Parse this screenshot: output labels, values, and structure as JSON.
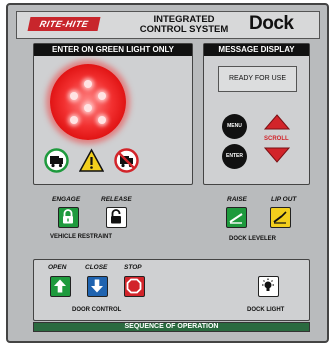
{
  "header": {
    "brand_logo": "RITE-HITE",
    "system_title_line1": "INTEGRATED",
    "system_title_line2": "CONTROL SYSTEM",
    "dock_logo": "Dock"
  },
  "light_section": {
    "title": "ENTER ON GREEN LIGHT ONLY",
    "light_color": "red",
    "icons": [
      "truck-ok-icon",
      "warning-icon",
      "truck-prohibited-icon"
    ]
  },
  "message_section": {
    "title": "MESSAGE DISPLAY",
    "display_text": "READY FOR USE",
    "menu_label": "MENU",
    "enter_label": "ENTER",
    "scroll_label": "SCROLL"
  },
  "vehicle_restraint": {
    "engage_label": "ENGAGE",
    "release_label": "RELEASE",
    "group_label": "VEHICLE RESTRAINT"
  },
  "dock_leveler": {
    "raise_label": "RAISE",
    "lip_out_label": "LIP OUT",
    "group_label": "DOCK LEVELER"
  },
  "door_control": {
    "open_label": "OPEN",
    "close_label": "CLOSE",
    "stop_label": "STOP",
    "group_label": "DOOR CONTROL"
  },
  "dock_light": {
    "label": "DOCK LIGHT"
  },
  "sequence_bar": {
    "label": "SEQUENCE OF OPERATION"
  },
  "colors": {
    "green": "#1e9a3d",
    "yellow": "#f2cf1d",
    "blue": "#1f63b0",
    "red": "#d2242a",
    "panel": "#b9bbbd"
  }
}
